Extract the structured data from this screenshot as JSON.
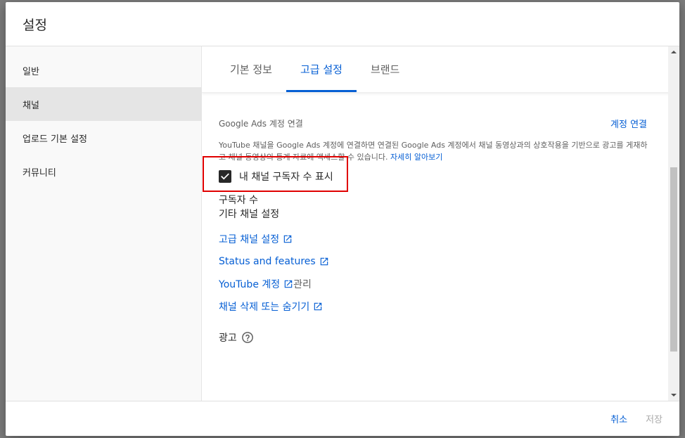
{
  "dialog": {
    "title": "설정"
  },
  "sidebar": {
    "items": [
      {
        "label": "일반"
      },
      {
        "label": "채널",
        "active": true
      },
      {
        "label": "업로드 기본 설정"
      },
      {
        "label": "커뮤니티"
      }
    ]
  },
  "tabs": [
    {
      "label": "기본 정보"
    },
    {
      "label": "고급 설정",
      "active": true
    },
    {
      "label": "브랜드"
    }
  ],
  "ads_link": {
    "title": "Google Ads 계정 연결",
    "button": "계정 연결",
    "description": "YouTube 채널을 Google Ads 계정에 연결하면 연결된 Google Ads 계정에서 채널 동영상과의 상호작용을 기반으로 광고를 게재하고 채널 동영상의 통계 자료에 액세스할 수 있습니다.",
    "learn_more": "자세히 알아보기"
  },
  "subscribers": {
    "title": "구독자 수",
    "checkbox_label": "내 채널 구독자 수 표시",
    "checked": true
  },
  "other_settings": {
    "title": "기타 채널 설정",
    "links": [
      {
        "label": "고급 채널 설정"
      },
      {
        "label": "Status and features"
      },
      {
        "label": "YouTube 계정",
        "suffix": "관리"
      },
      {
        "label": "채널 삭제 또는 숨기기"
      }
    ]
  },
  "ads_section": {
    "title": "광고"
  },
  "footer": {
    "cancel": "취소",
    "save": "저장"
  },
  "colors": {
    "accent": "#065fd4",
    "highlight_border": "#e00000",
    "text": "#282828",
    "muted": "#606060"
  }
}
